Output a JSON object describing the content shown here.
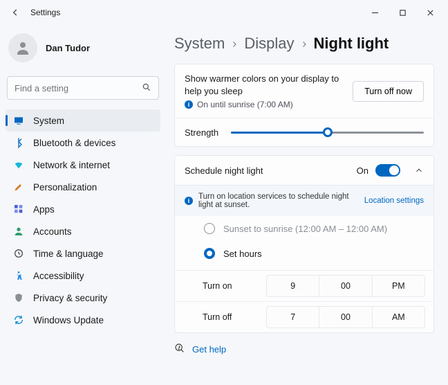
{
  "window": {
    "title": "Settings"
  },
  "user": {
    "name": "Dan Tudor"
  },
  "search": {
    "placeholder": "Find a setting"
  },
  "nav": {
    "items": [
      {
        "label": "System"
      },
      {
        "label": "Bluetooth & devices"
      },
      {
        "label": "Network & internet"
      },
      {
        "label": "Personalization"
      },
      {
        "label": "Apps"
      },
      {
        "label": "Accounts"
      },
      {
        "label": "Time & language"
      },
      {
        "label": "Accessibility"
      },
      {
        "label": "Privacy & security"
      },
      {
        "label": "Windows Update"
      }
    ]
  },
  "breadcrumb": {
    "a": "System",
    "b": "Display",
    "c": "Night light"
  },
  "intro": {
    "desc": "Show warmer colors on your display to help you sleep",
    "status": "On until sunrise (7:00 AM)",
    "button": "Turn off now"
  },
  "strength": {
    "label": "Strength"
  },
  "schedule": {
    "title": "Schedule night light",
    "state": "On",
    "banner": "Turn on location services to schedule night light at sunset.",
    "banner_link": "Location settings",
    "radio1": "Sunset to sunrise (12:00 AM – 12:00 AM)",
    "radio2": "Set hours",
    "turn_on": "Turn on",
    "on_h": "9",
    "on_m": "00",
    "on_ap": "PM",
    "turn_off": "Turn off",
    "off_h": "7",
    "off_m": "00",
    "off_ap": "AM"
  },
  "help": {
    "label": "Get help"
  }
}
